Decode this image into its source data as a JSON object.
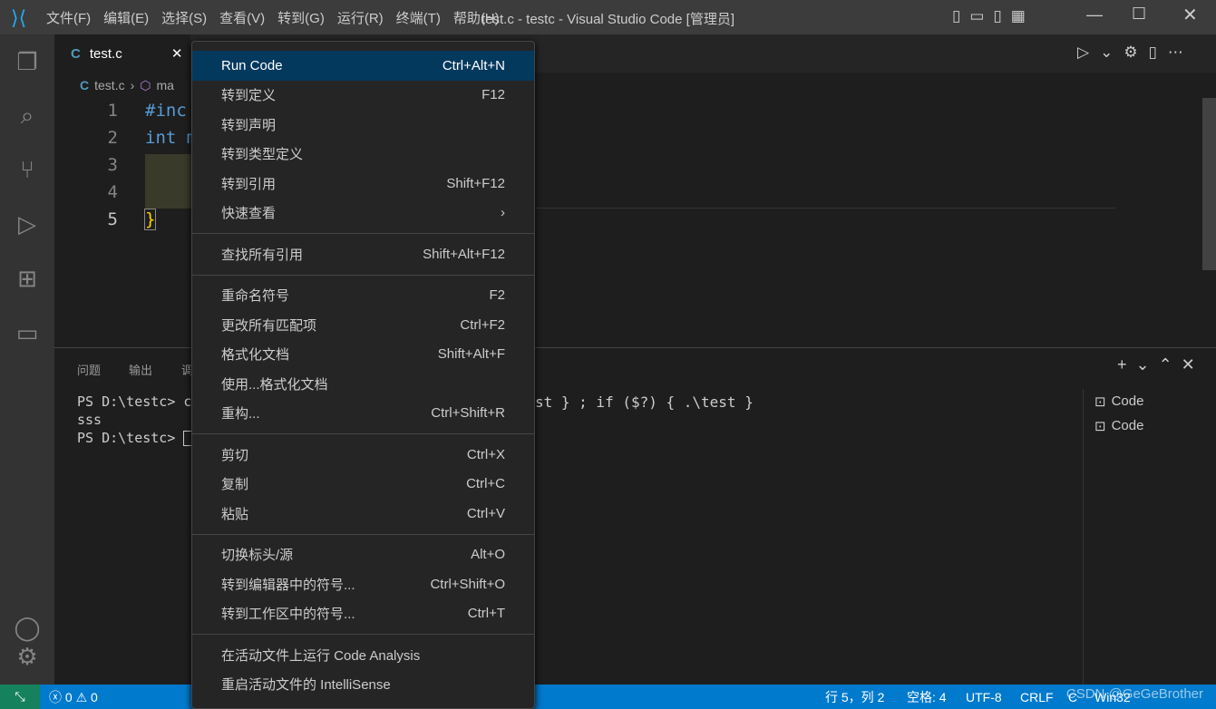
{
  "title_bar": {
    "menus": [
      "文件(F)",
      "编辑(E)",
      "选择(S)",
      "查看(V)",
      "转到(G)",
      "运行(R)",
      "终端(T)",
      "帮助(H)"
    ],
    "title": "test.c - testc - Visual Studio Code [管理员]"
  },
  "tab": {
    "label": "test.c"
  },
  "breadcrumb": {
    "file": "test.c",
    "symbol": "ma"
  },
  "editor": {
    "lines": [
      {
        "n": "1",
        "code": "#inc"
      },
      {
        "n": "2",
        "code": "int m"
      },
      {
        "n": "3",
        "code": ""
      },
      {
        "n": "4",
        "code": ""
      },
      {
        "n": "5",
        "code": "}"
      }
    ]
  },
  "panel": {
    "tabs": [
      "问题",
      "输出",
      "调"
    ],
    "terminal": [
      "PS D:\\testc> c",
      "sss",
      "PS D:\\testc> "
    ],
    "terminal_tail": "st } ; if ($?) { .\\test }",
    "terminals": [
      "Code",
      "Code"
    ]
  },
  "context_menu": {
    "groups": [
      [
        {
          "label": "Run Code",
          "shortcut": "Ctrl+Alt+N"
        },
        {
          "label": "转到定义",
          "shortcut": "F12"
        },
        {
          "label": "转到声明",
          "shortcut": ""
        },
        {
          "label": "转到类型定义",
          "shortcut": ""
        },
        {
          "label": "转到引用",
          "shortcut": "Shift+F12"
        },
        {
          "label": "快速查看",
          "shortcut": "›"
        }
      ],
      [
        {
          "label": "查找所有引用",
          "shortcut": "Shift+Alt+F12"
        }
      ],
      [
        {
          "label": "重命名符号",
          "shortcut": "F2"
        },
        {
          "label": "更改所有匹配项",
          "shortcut": "Ctrl+F2"
        },
        {
          "label": "格式化文档",
          "shortcut": "Shift+Alt+F"
        },
        {
          "label": "使用...格式化文档",
          "shortcut": ""
        },
        {
          "label": "重构...",
          "shortcut": "Ctrl+Shift+R"
        }
      ],
      [
        {
          "label": "剪切",
          "shortcut": "Ctrl+X"
        },
        {
          "label": "复制",
          "shortcut": "Ctrl+C"
        },
        {
          "label": "粘贴",
          "shortcut": "Ctrl+V"
        }
      ],
      [
        {
          "label": "切换标头/源",
          "shortcut": "Alt+O"
        },
        {
          "label": "转到编辑器中的符号...",
          "shortcut": "Ctrl+Shift+O"
        },
        {
          "label": "转到工作区中的符号...",
          "shortcut": "Ctrl+T"
        }
      ],
      [
        {
          "label": "在活动文件上运行 Code Analysis",
          "shortcut": ""
        },
        {
          "label": "重启活动文件的 IntelliSense",
          "shortcut": ""
        }
      ]
    ]
  },
  "status_bar": {
    "errors": "0",
    "warnings": "0",
    "position": "行 5，列 2",
    "spaces": "空格: 4",
    "encoding": "UTF-8",
    "eol": "CRLF",
    "language": "C",
    "platform": "Win32"
  },
  "watermark": "CSDN @GeGeBrother",
  "colors": {
    "status": "#007acc",
    "selection": "#04395e",
    "remote": "#16825d"
  }
}
